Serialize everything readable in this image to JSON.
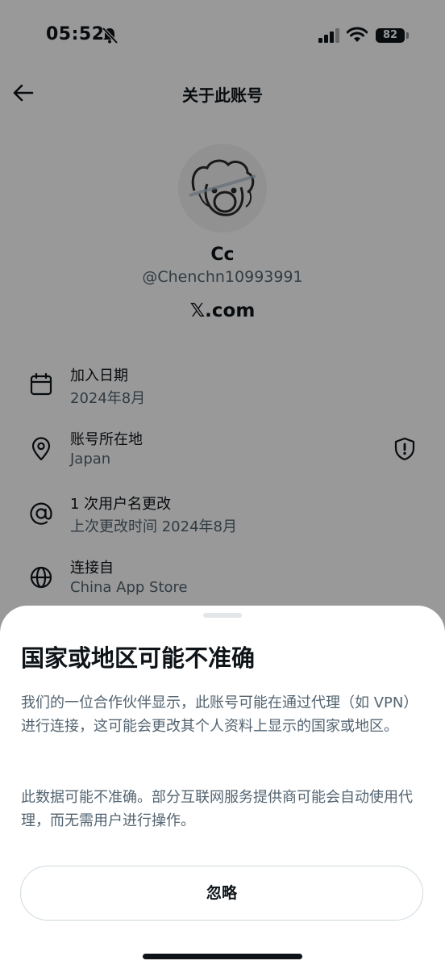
{
  "status_bar": {
    "time": "05:52",
    "battery": "82"
  },
  "header": {
    "title": "关于此账号"
  },
  "profile": {
    "name": "Cc",
    "handle": "@Chenchn10993991",
    "site": "𝕏.com"
  },
  "info_rows": [
    {
      "title": "加入日期",
      "subtitle": "2024年8月",
      "icon": "calendar-icon"
    },
    {
      "title": "账号所在地",
      "subtitle": "Japan",
      "icon": "location-pin-icon"
    },
    {
      "title": "1 次用户名更改",
      "subtitle": "上次更改时间 2024年8月",
      "icon": "at-sign-icon"
    },
    {
      "title": "连接自",
      "subtitle": "China App Store",
      "icon": "globe-icon"
    }
  ],
  "sheet": {
    "title": "国家或地区可能不准确",
    "paragraph1": "我们的一位合作伙伴显示，此账号可能在通过代理（如 VPN）进行连接，这可能会更改其个人资料上显示的国家或地区。",
    "paragraph2": "此数据可能不准确。部分互联网服务提供商可能会自动使用代理，而无需用户进行操作。",
    "button": "忽略"
  }
}
